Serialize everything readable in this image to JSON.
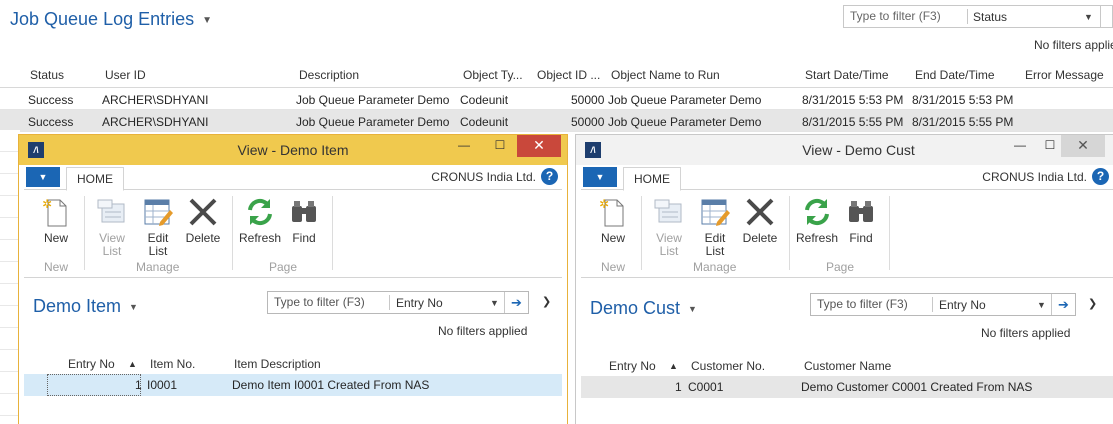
{
  "background": {
    "title": "Job Queue Log Entries",
    "filter_placeholder": "Type to filter (F3)",
    "filter_field": "Status",
    "no_filters": "No filters applied",
    "columns": [
      "Status",
      "User ID",
      "Description",
      "Object Ty...",
      "Object ID ...",
      "Object Name to Run",
      "Start Date/Time",
      "End Date/Time",
      "Error Message"
    ],
    "rows": [
      [
        "Success",
        "ARCHER\\SDHYANI",
        "Job Queue Parameter Demo",
        "Codeunit",
        "50000",
        "Job Queue Parameter Demo",
        "8/31/2015 5:53 PM",
        "8/31/2015 5:53 PM",
        ""
      ],
      [
        "Success",
        "ARCHER\\SDHYANI",
        "Job Queue Parameter Demo",
        "Codeunit",
        "50000",
        "Job Queue Parameter Demo",
        "8/31/2015 5:55 PM",
        "8/31/2015 5:55 PM",
        ""
      ]
    ]
  },
  "win1": {
    "app_icon": "nav-logo-icon",
    "title": "View - Demo Item",
    "tab": "HOME",
    "company": "CRONUS India Ltd.",
    "buttons": {
      "new": "New",
      "view_list_1": "View",
      "view_list_2": "List",
      "edit_list_1": "Edit",
      "edit_list_2": "List",
      "delete": "Delete",
      "refresh": "Refresh",
      "find": "Find"
    },
    "groups": {
      "new": "New",
      "manage": "Manage",
      "page": "Page"
    },
    "page_title": "Demo Item",
    "filter_placeholder": "Type to filter (F3)",
    "filter_field": "Entry No",
    "no_filters": "No filters applied",
    "columns": {
      "c1": "Entry No",
      "c2": "Item No.",
      "c3": "Item Description"
    },
    "row": {
      "c1": "1",
      "c2": "I0001",
      "c3": "Demo Item I0001 Created From NAS"
    }
  },
  "win2": {
    "app_icon": "nav-logo-icon",
    "title": "View - Demo Cust",
    "tab": "HOME",
    "company": "CRONUS India Ltd.",
    "buttons": {
      "new": "New",
      "view_list_1": "View",
      "view_list_2": "List",
      "edit_list_1": "Edit",
      "edit_list_2": "List",
      "delete": "Delete",
      "refresh": "Refresh",
      "find": "Find"
    },
    "groups": {
      "new": "New",
      "manage": "Manage",
      "page": "Page"
    },
    "page_title": "Demo Cust",
    "filter_placeholder": "Type to filter (F3)",
    "filter_field": "Entry No",
    "no_filters": "No filters applied",
    "columns": {
      "c1": "Entry No",
      "c2": "Customer No.",
      "c3": "Customer Name"
    },
    "row": {
      "c1": "1",
      "c2": "C0001",
      "c3": "Demo Customer C0001 Created From NAS"
    }
  },
  "colors": {
    "accent": "#1f5fa8",
    "active_titlebar": "#f0c94e",
    "close": "#c9483b",
    "selection": "#d6eaf8"
  }
}
